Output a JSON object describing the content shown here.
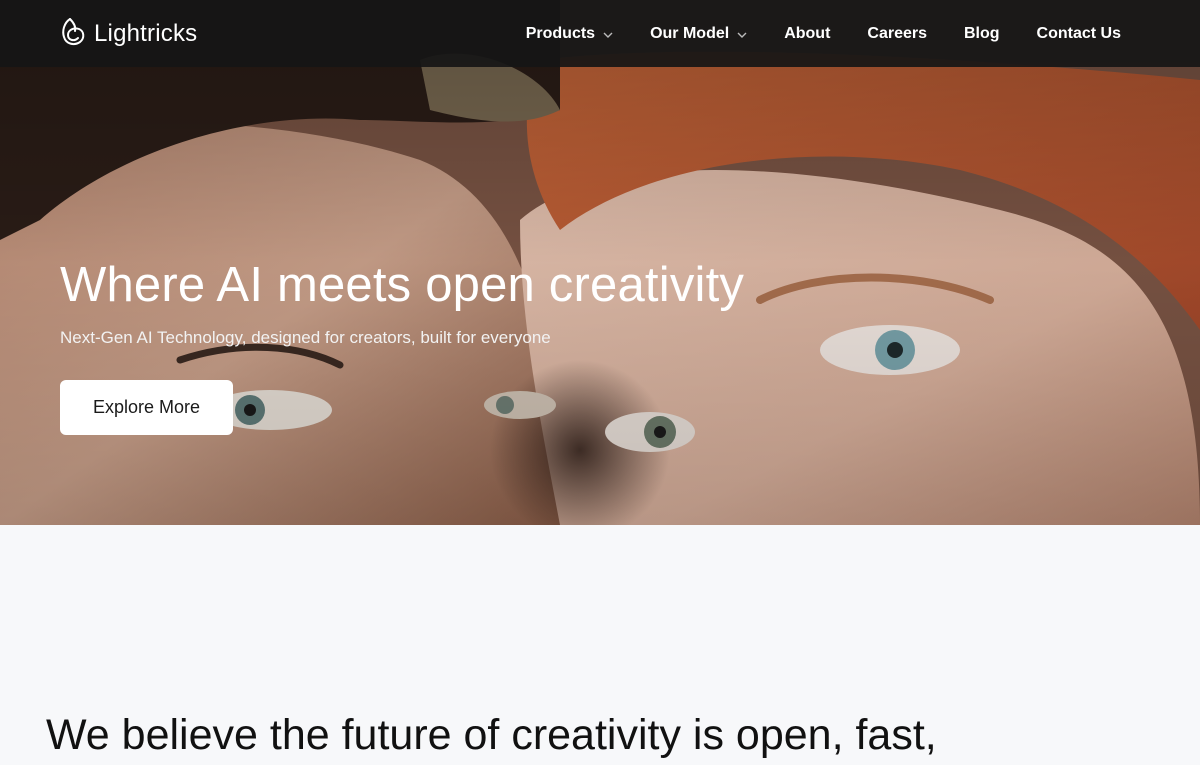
{
  "brand": {
    "name": "Lightricks"
  },
  "nav": {
    "items": [
      {
        "label": "Products",
        "has_dropdown": true
      },
      {
        "label": "Our Model",
        "has_dropdown": true
      },
      {
        "label": "About",
        "has_dropdown": false
      },
      {
        "label": "Careers",
        "has_dropdown": false
      },
      {
        "label": "Blog",
        "has_dropdown": false
      },
      {
        "label": "Contact Us",
        "has_dropdown": false
      }
    ]
  },
  "hero": {
    "title": "Where AI meets open creativity",
    "subtitle": "Next-Gen AI Technology, designed for creators, built for everyone",
    "cta_label": "Explore More",
    "image_icon": "hero-photo-two-faces"
  },
  "section": {
    "heading": "We believe the future of creativity is open, fast,"
  },
  "colors": {
    "navbar_bg": "#161616",
    "page_bg": "#f7f8fa",
    "cta_bg": "#ffffff",
    "text_dark": "#111111"
  }
}
